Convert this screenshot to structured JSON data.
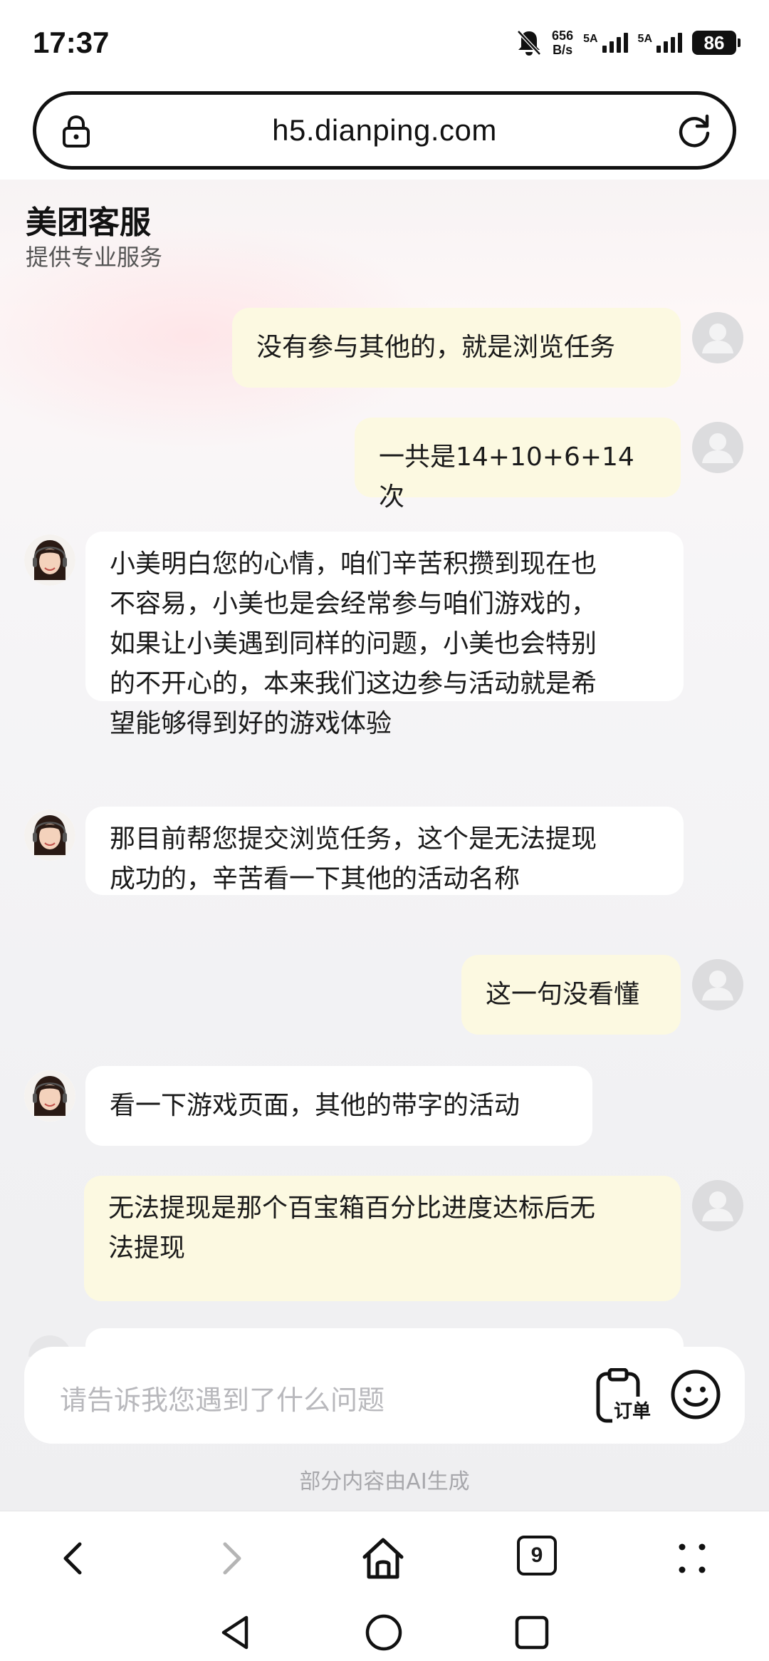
{
  "status_bar": {
    "time": "17:37",
    "net_speed_value": "656",
    "net_speed_unit": "B/s",
    "sim1_label": "5A",
    "sim2_label": "5A",
    "battery": "86"
  },
  "browser": {
    "url": "h5.dianping.com",
    "tab_count": "9"
  },
  "header": {
    "title": "美团客服",
    "subtitle": "提供专业服务"
  },
  "messages": [
    {
      "from": "user",
      "text": "没有参与其他的，就是浏览任务"
    },
    {
      "from": "user",
      "text": "一共是14+10+6+14次"
    },
    {
      "from": "bot",
      "lines": [
        "小美明白您的心情，咱们辛苦积攒到现在也",
        "不容易，小美也是会经常参与咱们游戏的，",
        "如果让小美遇到同样的问题，小美也会特别",
        "的不开心的，本来我们这边参与活动就是希",
        "望能够得到好的游戏体验"
      ]
    },
    {
      "from": "bot",
      "lines": [
        "那目前帮您提交浏览任务，这个是无法提现",
        "成功的，辛苦看一下其他的活动名称"
      ]
    },
    {
      "from": "user",
      "text": "这一句没看懂"
    },
    {
      "from": "bot",
      "text": "看一下游戏页面，其他的带字的活动"
    },
    {
      "from": "user",
      "lines": [
        "无法提现是那个百宝箱百分比进度达标后无",
        "法提现"
      ]
    }
  ],
  "input": {
    "placeholder": "请告诉我您遇到了什么问题",
    "order_label": "订单"
  },
  "ai_note": "部分内容由AI生成",
  "colors": {
    "user_bubble": "#fcf9e1",
    "bot_bubble": "#ffffff",
    "background": "#f1f1f3"
  },
  "icons": [
    "bell-off-icon",
    "lock-icon",
    "reload-icon",
    "order-icon",
    "emoji-icon",
    "back-icon",
    "forward-icon",
    "home-icon",
    "tabs-icon",
    "menu-icon"
  ]
}
